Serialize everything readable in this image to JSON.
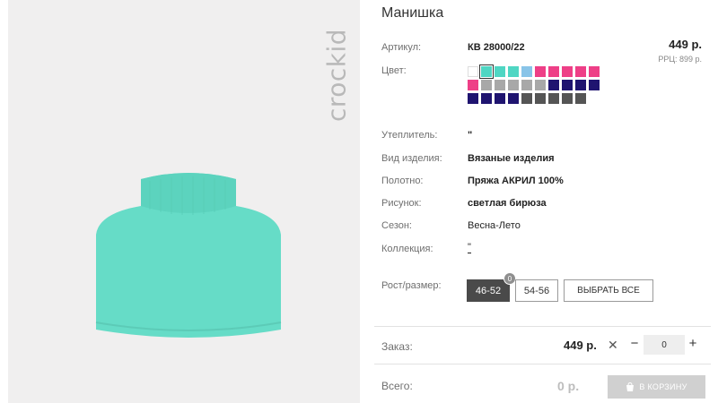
{
  "product": {
    "title": "Манишка",
    "logo_text": "crockid",
    "price": "449 р.",
    "rrp": "РРЦ: 899 р."
  },
  "details": {
    "article_label": "Артикул:",
    "article_value": "КВ 28000/22",
    "color_label": "Цвет:",
    "insulation_label": "Утеплитель:",
    "insulation_value": "\"",
    "type_label": "Вид изделия:",
    "type_value": "Вязаные изделия",
    "fabric_label": "Полотно:",
    "fabric_value": "Пряжа АКРИЛ 100%",
    "pattern_label": "Рисунок:",
    "pattern_value": "светлая бирюза",
    "season_label": "Сезон:",
    "season_value": "Весна-Лето",
    "collection_label": "Коллекция:",
    "collection_value": "\"",
    "size_label": "Рост/размер:"
  },
  "colors": [
    "#ffffff",
    "#4fd6c3",
    "#4fd6c3",
    "#4fd6c3",
    "#89c4e8",
    "#ee3f87",
    "#ee3f87",
    "#ee3f87",
    "#ee3f87",
    "#ee3f87",
    "#ee3f87",
    "#a8a8a8",
    "#a8a8a8",
    "#a8a8a8",
    "#a8a8a8",
    "#a8a8a8",
    "#1f1470",
    "#1f1470",
    "#1f1470",
    "#1f1470",
    "#1f1470",
    "#1f1470",
    "#1f1470",
    "#1f1470",
    "#555555",
    "#555555",
    "#555555",
    "#555555",
    "#555555"
  ],
  "selected_color_index": 1,
  "sizes": {
    "active": "46-52",
    "active_badge": "0",
    "other": "54-56",
    "select_all": "ВЫБРАТЬ ВСЕ"
  },
  "order": {
    "label": "Заказ:",
    "price": "449 р.",
    "times": "✕",
    "minus": "−",
    "quantity": "0",
    "plus": "+"
  },
  "total": {
    "label": "Всего:",
    "value": "0 р.",
    "cart_button": "В КОРЗИНУ"
  }
}
